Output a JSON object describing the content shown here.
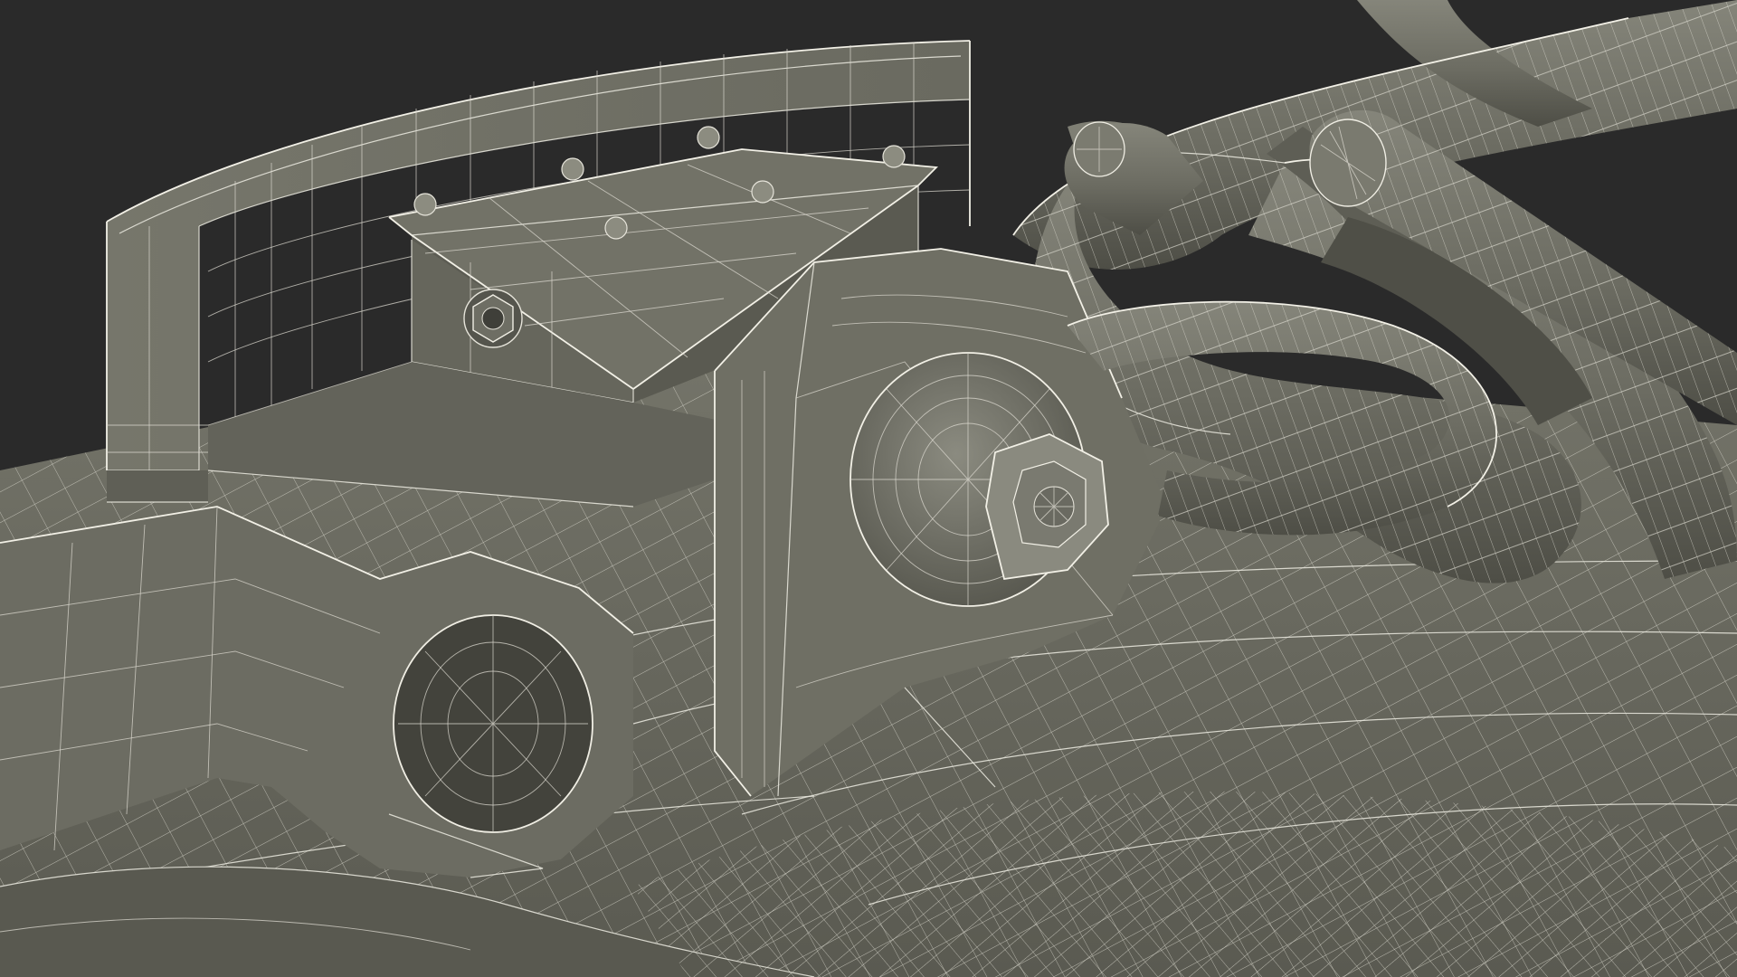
{
  "scene": {
    "description_visible_text": "",
    "colors": {
      "background": "#2a2a2a",
      "model_base": "#6f6f64",
      "model_shadow": "#4b4b43",
      "model_highlight": "#8a8a7e",
      "wireframe": "#e6e4da"
    },
    "objects": [
      "curved-rail-wall",
      "junction-box",
      "bolted-bracket",
      "shackle-pin",
      "hex-nut",
      "chain-links",
      "anchor-eye",
      "deck-plate"
    ]
  }
}
